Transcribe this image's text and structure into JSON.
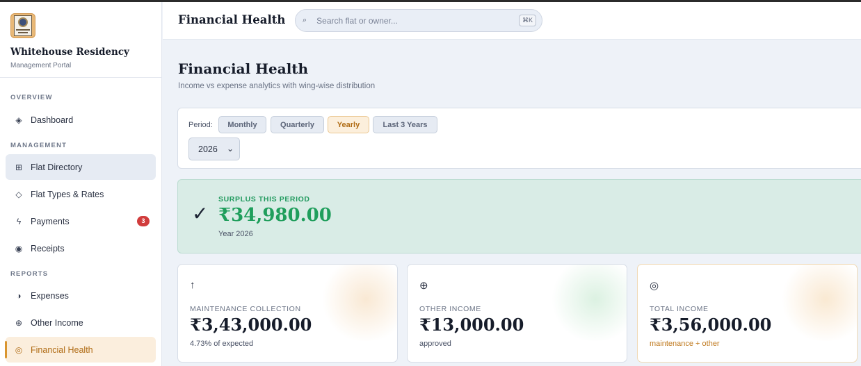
{
  "brand": {
    "name": "Whitehouse Residency",
    "subtitle": "Management Portal"
  },
  "nav": {
    "sections": [
      {
        "label": "OVERVIEW",
        "items": [
          {
            "label": "Dashboard",
            "icon": "diamond-icon"
          }
        ]
      },
      {
        "label": "MANAGEMENT",
        "items": [
          {
            "label": "Flat Directory",
            "icon": "grid-icon"
          },
          {
            "label": "Flat Types & Rates",
            "icon": "diamond-outline-icon"
          },
          {
            "label": "Payments",
            "icon": "bolt-icon",
            "badge": "3"
          },
          {
            "label": "Receipts",
            "icon": "record-icon"
          }
        ]
      },
      {
        "label": "REPORTS",
        "items": [
          {
            "label": "Expenses",
            "icon": "half-circle-icon"
          },
          {
            "label": "Other Income",
            "icon": "crosshair-icon"
          },
          {
            "label": "Financial Health",
            "icon": "target-icon"
          }
        ]
      }
    ]
  },
  "topbar": {
    "title": "Financial Health",
    "search_placeholder": "Search flat or owner...",
    "shortcut": "⌘K"
  },
  "page": {
    "title": "Financial Health",
    "subtitle": "Income vs expense analytics with wing-wise distribution"
  },
  "period": {
    "label": "Period:",
    "options": [
      "Monthly",
      "Quarterly",
      "Yearly",
      "Last 3 Years"
    ],
    "selected": "Yearly",
    "year": "2026"
  },
  "surplus": {
    "label": "SURPLUS THIS PERIOD",
    "amount": "₹34,980.00",
    "sub": "Year 2026"
  },
  "stats": [
    {
      "label": "MAINTENANCE COLLECTION",
      "value": "₹3,43,000.00",
      "note": "4.73% of expected"
    },
    {
      "label": "OTHER INCOME",
      "value": "₹13,000.00",
      "note": "approved"
    },
    {
      "label": "TOTAL INCOME",
      "value": "₹3,56,000.00",
      "note": "maintenance + other"
    }
  ],
  "colors": {
    "accent_gold": "#d9952f",
    "surplus_green": "#1f9e5c",
    "badge_red": "#d13c3c"
  }
}
